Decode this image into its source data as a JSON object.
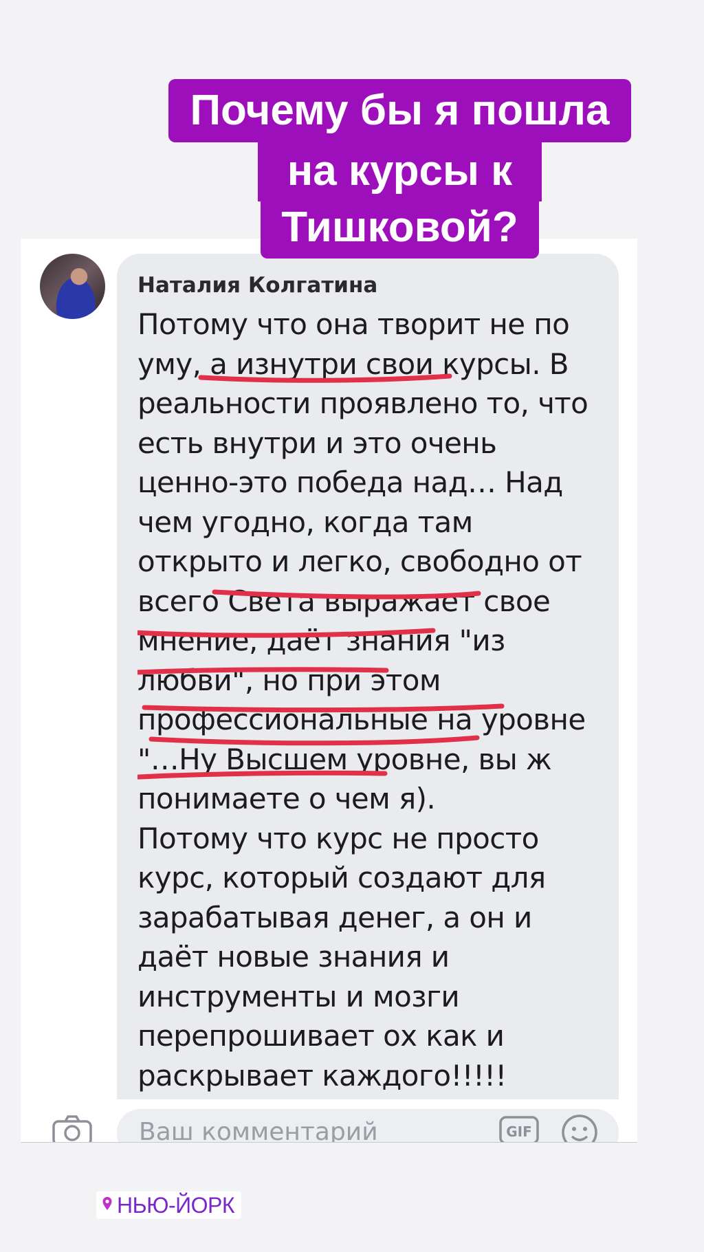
{
  "title_sticker": {
    "lines": [
      "Почему бы я пошла",
      "на курсы к",
      "Тишковой?"
    ]
  },
  "comment": {
    "author": "Наталия Колгатина",
    "lines": [
      "Потому что она творит не по",
      "уму, а изнутри свои курсы. В",
      "реальности проявлено то, что",
      "есть внутри и это очень",
      "ценно-это победа над… Над",
      "чем угодно, когда там",
      "открыто и легко, свободно от",
      "всего Света выражает свое",
      "мнение, даёт знания \"из",
      "любви\", но при этом",
      "профессиональные на уровне",
      "\"…Ну Высшем уровне, вы ж",
      "понимаете о чем я).",
      "Потому что курс не просто",
      "курс, который создают для",
      "зарабатывая денег, а он и",
      "даёт новые знания и",
      "инструменты и мозги",
      "перепрошивает ох как и",
      "раскрывает каждого!!!!!"
    ]
  },
  "comment_input": {
    "placeholder": "Ваш комментарий"
  },
  "icons": {
    "camera": "camera-icon",
    "gif": "gif-icon",
    "emoji": "smile-icon",
    "location_pin": "location-pin-icon"
  },
  "location": {
    "label": "НЬЮ-ЙОРК"
  },
  "colors": {
    "sticker_bg": "#9e0fbc",
    "underline": "#e0304a",
    "location_text": "#7a27c9"
  }
}
